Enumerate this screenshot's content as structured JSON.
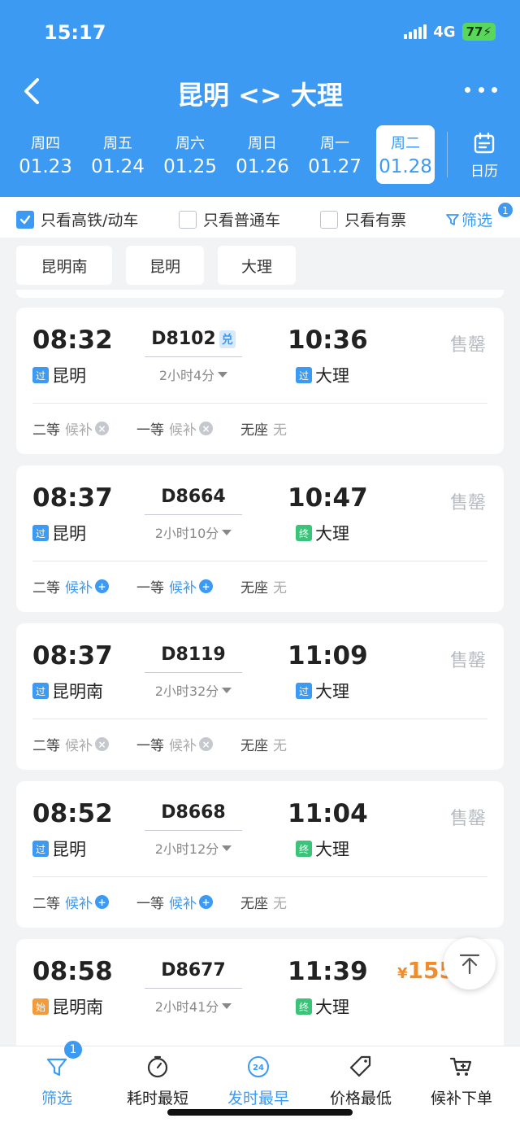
{
  "status_bar": {
    "time": "15:17",
    "network": "4G",
    "battery": "77"
  },
  "header": {
    "title": "昆明 <> 大理"
  },
  "dates": [
    {
      "weekday": "周四",
      "date": "01.23",
      "active": false
    },
    {
      "weekday": "周五",
      "date": "01.24",
      "active": false
    },
    {
      "weekday": "周六",
      "date": "01.25",
      "active": false
    },
    {
      "weekday": "周日",
      "date": "01.26",
      "active": false
    },
    {
      "weekday": "周一",
      "date": "01.27",
      "active": false
    },
    {
      "weekday": "周二",
      "date": "01.28",
      "active": true
    }
  ],
  "calendar_label": "日历",
  "filters": {
    "high_speed": {
      "label": "只看高铁/动车",
      "checked": true
    },
    "normal": {
      "label": "只看普通车",
      "checked": false
    },
    "available": {
      "label": "只看有票",
      "checked": false
    },
    "filter_label": "筛选",
    "filter_badge": "1"
  },
  "stations": [
    "昆明南",
    "昆明",
    "大理"
  ],
  "trains": [
    {
      "dep_time": "08:32",
      "train_no": "D8102",
      "exchange_tag": "兑",
      "duration": "2小时4分",
      "arr_time": "10:36",
      "from_tag": "过",
      "from": "昆明",
      "to_tag": "过",
      "to": "大理",
      "status": "售罄",
      "seats": [
        {
          "class": "二等",
          "avail": "候补",
          "icon": "x"
        },
        {
          "class": "一等",
          "avail": "候补",
          "icon": "x"
        },
        {
          "class": "无座",
          "avail": "无",
          "icon": ""
        }
      ]
    },
    {
      "dep_time": "08:37",
      "train_no": "D8664",
      "exchange_tag": "",
      "duration": "2小时10分",
      "arr_time": "10:47",
      "from_tag": "过",
      "from": "昆明",
      "to_tag": "终",
      "to": "大理",
      "status": "售罄",
      "seats": [
        {
          "class": "二等",
          "avail": "候补",
          "icon": "plus"
        },
        {
          "class": "一等",
          "avail": "候补",
          "icon": "plus"
        },
        {
          "class": "无座",
          "avail": "无",
          "icon": ""
        }
      ]
    },
    {
      "dep_time": "08:37",
      "train_no": "D8119",
      "exchange_tag": "",
      "duration": "2小时32分",
      "arr_time": "11:09",
      "from_tag": "过",
      "from": "昆明南",
      "to_tag": "过",
      "to": "大理",
      "status": "售罄",
      "seats": [
        {
          "class": "二等",
          "avail": "候补",
          "icon": "x"
        },
        {
          "class": "一等",
          "avail": "候补",
          "icon": "x"
        },
        {
          "class": "无座",
          "avail": "无",
          "icon": ""
        }
      ]
    },
    {
      "dep_time": "08:52",
      "train_no": "D8668",
      "exchange_tag": "",
      "duration": "2小时12分",
      "arr_time": "11:04",
      "from_tag": "过",
      "from": "昆明",
      "to_tag": "终",
      "to": "大理",
      "status": "售罄",
      "seats": [
        {
          "class": "二等",
          "avail": "候补",
          "icon": "plus"
        },
        {
          "class": "一等",
          "avail": "候补",
          "icon": "plus"
        },
        {
          "class": "无座",
          "avail": "无",
          "icon": ""
        }
      ]
    },
    {
      "dep_time": "08:58",
      "train_no": "D8677",
      "exchange_tag": "",
      "duration": "2小时41分",
      "arr_time": "11:39",
      "from_tag": "始",
      "from": "昆明南",
      "to_tag": "终",
      "to": "大理",
      "price_symbol": "¥",
      "price": "155",
      "seats": []
    }
  ],
  "bottom_tabs": [
    {
      "label": "筛选",
      "icon": "filter-icon",
      "active": true,
      "badge": "1"
    },
    {
      "label": "耗时最短",
      "icon": "timer-icon",
      "active": false
    },
    {
      "label": "发时最早",
      "icon": "clock-24-icon",
      "active": true,
      "icon_text": "24"
    },
    {
      "label": "价格最低",
      "icon": "price-tag-icon",
      "active": false
    },
    {
      "label": "候补下单",
      "icon": "cart-icon",
      "active": false
    }
  ],
  "colors": {
    "primary": "#3c9af3",
    "price": "#f08c2a",
    "end_tag": "#3cc37a",
    "start_tag": "#f39a3c"
  }
}
